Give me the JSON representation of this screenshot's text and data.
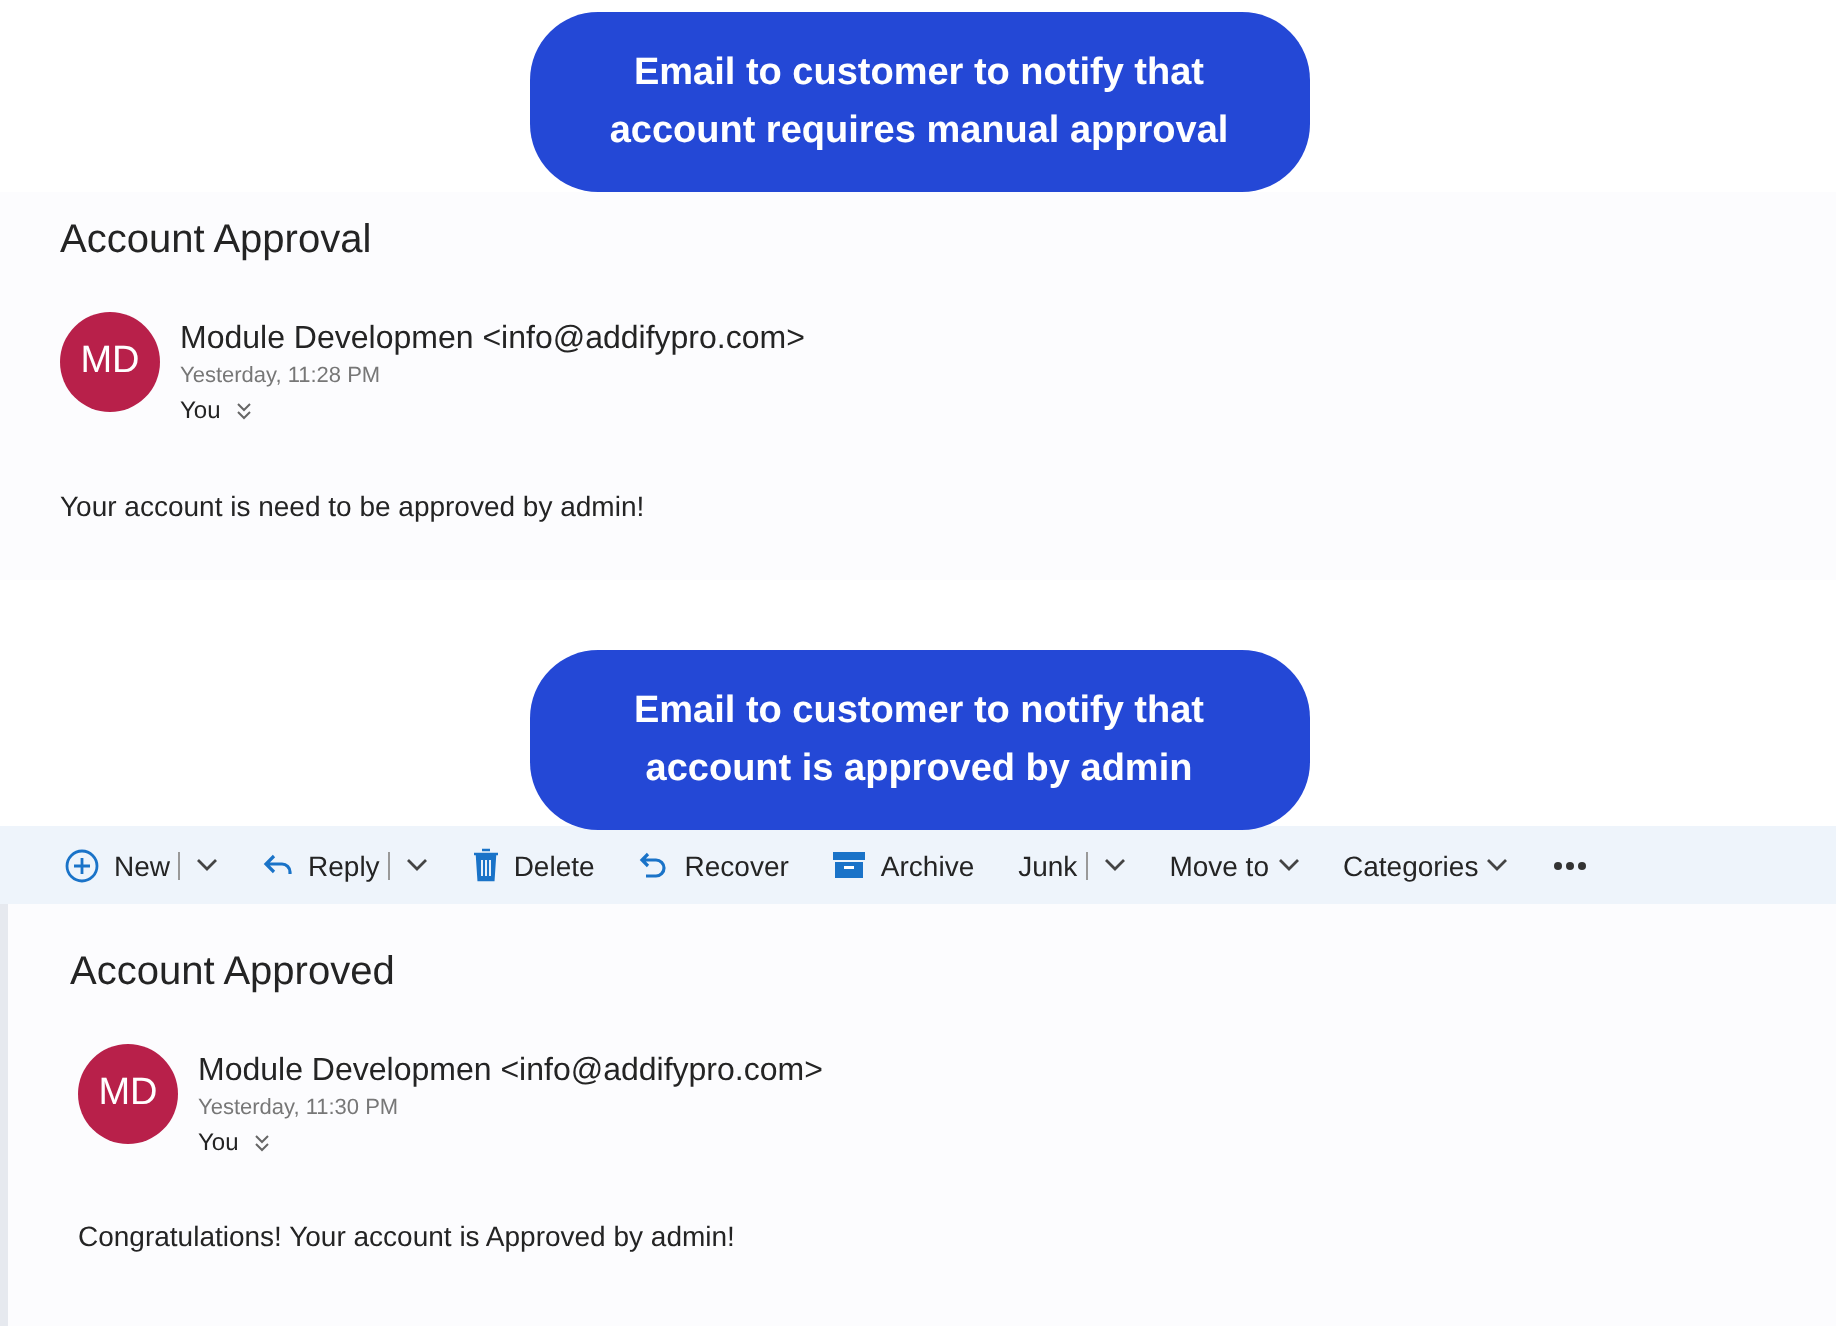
{
  "sections": [
    {
      "callout": [
        "Email to customer to notify that",
        "account requires manual approval"
      ],
      "email": {
        "subject": "Account Approval",
        "initials": "MD",
        "sender": "Module Developmen <info@addifypro.com>",
        "time": "Yesterday, 11:28 PM",
        "recipient": "You",
        "body": "Your account is need to be approved by admin!"
      }
    },
    {
      "callout": [
        "Email to customer to notify that",
        "account is approved by admin"
      ],
      "toolbar": [
        {
          "label": "New",
          "kind": "split"
        },
        {
          "label": "Reply",
          "kind": "split"
        },
        {
          "label": "Delete",
          "kind": "plain"
        },
        {
          "label": "Recover",
          "kind": "plain"
        },
        {
          "label": "Archive",
          "kind": "plain"
        },
        {
          "label": "Junk",
          "kind": "split"
        },
        {
          "label": "Move to",
          "kind": "dropdown"
        },
        {
          "label": "Categories",
          "kind": "dropdown"
        },
        {
          "kind": "more"
        }
      ],
      "email": {
        "subject": "Account Approved",
        "initials": "MD",
        "sender": "Module Developmen <info@addifypro.com>",
        "time": "Yesterday, 11:30 PM",
        "recipient": "You",
        "body": "Congratulations! Your account is Approved by admin!"
      }
    }
  ]
}
